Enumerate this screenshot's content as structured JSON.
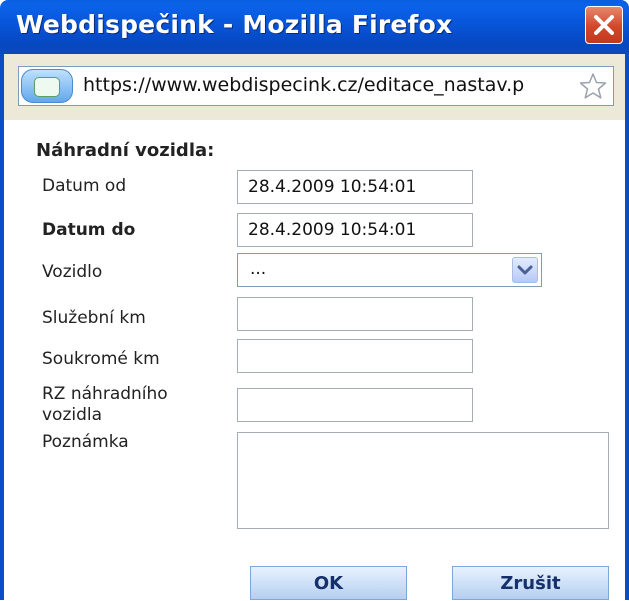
{
  "window": {
    "title": "Webdispečink - Mozilla Firefox",
    "url": "https://www.webdispecink.cz/editace_nastav.p"
  },
  "form": {
    "heading": "Náhradní vozidla:",
    "datum_od_label": "Datum od",
    "datum_od_value": "28.4.2009 10:54:01",
    "datum_do_label": "Datum do",
    "datum_do_value": "28.4.2009 10:54:01",
    "vozidlo_label": "Vozidlo",
    "vozidlo_value": "...",
    "sluzebni_km_label": "Služební km",
    "sluzebni_km_value": "",
    "soukrome_km_label": "Soukromé km",
    "soukrome_km_value": "",
    "rz_label_line1": "RZ náhradního",
    "rz_label_line2": "vozidla",
    "rz_value": "",
    "poznamka_label": "Poznámka",
    "poznamka_value": ""
  },
  "buttons": {
    "ok_label": "OK",
    "cancel_label": "Zrušit"
  },
  "colors": {
    "titlebar": "#0855d8",
    "close": "#d2472a",
    "button_text": "#15306b"
  }
}
